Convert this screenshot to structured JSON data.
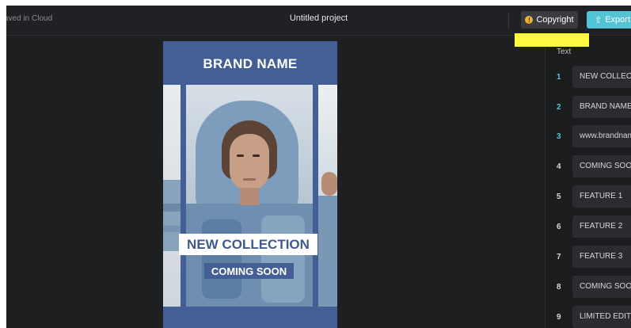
{
  "topbar": {
    "saved_status": "aved in Cloud",
    "project_title": "Untitled project",
    "copyright_label": "Copyright",
    "copyright_icon_glyph": "!",
    "export_label": "Export",
    "export_icon_glyph": "⇧"
  },
  "canvas": {
    "brand_name": "BRAND NAME",
    "headline": "NEW COLLECTION",
    "subhead": "COMING SOON",
    "background_color": "#445f95"
  },
  "panel": {
    "title": "Text",
    "items": [
      {
        "num": "1",
        "text": "NEW COLLECTION"
      },
      {
        "num": "2",
        "text": "BRAND NAME"
      },
      {
        "num": "3",
        "text": "www.brandname.com"
      },
      {
        "num": "4",
        "text": "COMING SOON"
      },
      {
        "num": "5",
        "text": "FEATURE 1"
      },
      {
        "num": "6",
        "text": "FEATURE 2"
      },
      {
        "num": "7",
        "text": "FEATURE 3"
      },
      {
        "num": "8",
        "text": "COMING SOON"
      },
      {
        "num": "9",
        "text": "LIMITED EDITION"
      }
    ]
  },
  "colors": {
    "accent": "#53c4d6",
    "highlight": "#fff840",
    "warning_icon": "#f0b429"
  }
}
